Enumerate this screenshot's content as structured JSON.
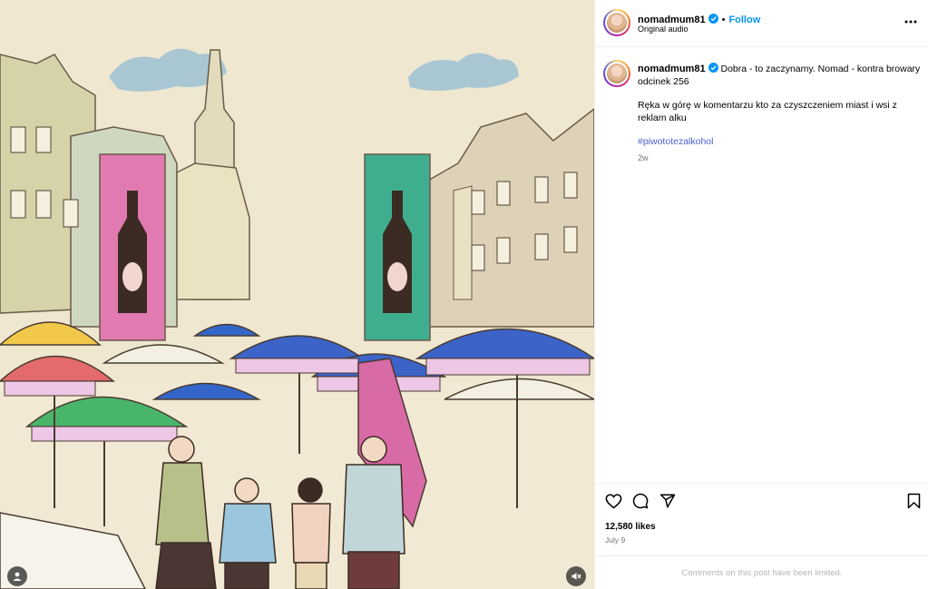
{
  "post": {
    "username": "nomadmum81",
    "follow_label": "Follow",
    "separator": "•",
    "audio": "Original audio",
    "caption_line1": "Dobra - to zaczynamy. Nomad - kontra browary odcinek 256",
    "caption_line2": "Ręka w górę w komentarzu kto za czyszczeniem miast i wsi z reklam alku",
    "hashtag": "#piwototezalkohol",
    "age": "2w",
    "likes": "12,580 likes",
    "date": "July 9",
    "comments_limited": "Comments on this post have been limited."
  },
  "icons": {
    "verified": "verified-badge-icon",
    "more": "more-options-icon",
    "like": "heart-icon",
    "comment": "comment-icon",
    "share": "send-icon",
    "save": "bookmark-icon",
    "user_tag": "user-tag-icon",
    "mute": "mute-icon"
  },
  "colors": {
    "accent": "#0095f6",
    "hashtag": "#4a5fd6",
    "muted_text": "#737373",
    "limited_text": "#b5b5b5"
  }
}
